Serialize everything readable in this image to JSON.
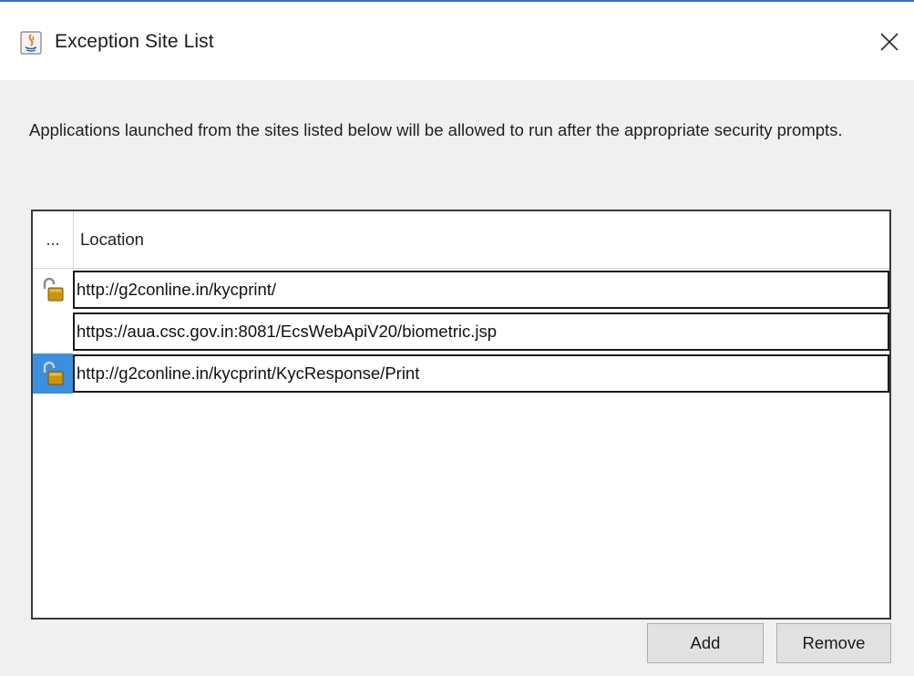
{
  "window": {
    "title": "Exception Site List",
    "icon": "java-icon",
    "close_icon": "close-icon"
  },
  "description": "Applications launched from the sites listed below will be allowed to run after the appropriate security prompts.",
  "table": {
    "columns": [
      "...",
      "Location"
    ],
    "rows": [
      {
        "location": "http://g2conline.in/kycprint/",
        "icon": "unlocked-padlock-icon",
        "selected": false
      },
      {
        "location": "https://aua.csc.gov.in:8081/EcsWebApiV20/biometric.jsp",
        "icon": "",
        "selected": false
      },
      {
        "location": "http://g2conline.in/kycprint/KycResponse/Print",
        "icon": "unlocked-padlock-icon",
        "selected": true
      }
    ]
  },
  "buttons": {
    "add": "Add",
    "remove": "Remove"
  },
  "colors": {
    "title_accent": "#2f72c4",
    "selection": "#3b8fe0",
    "padlock": "#c8960f",
    "dialog_bg": "#f0f0f0"
  }
}
